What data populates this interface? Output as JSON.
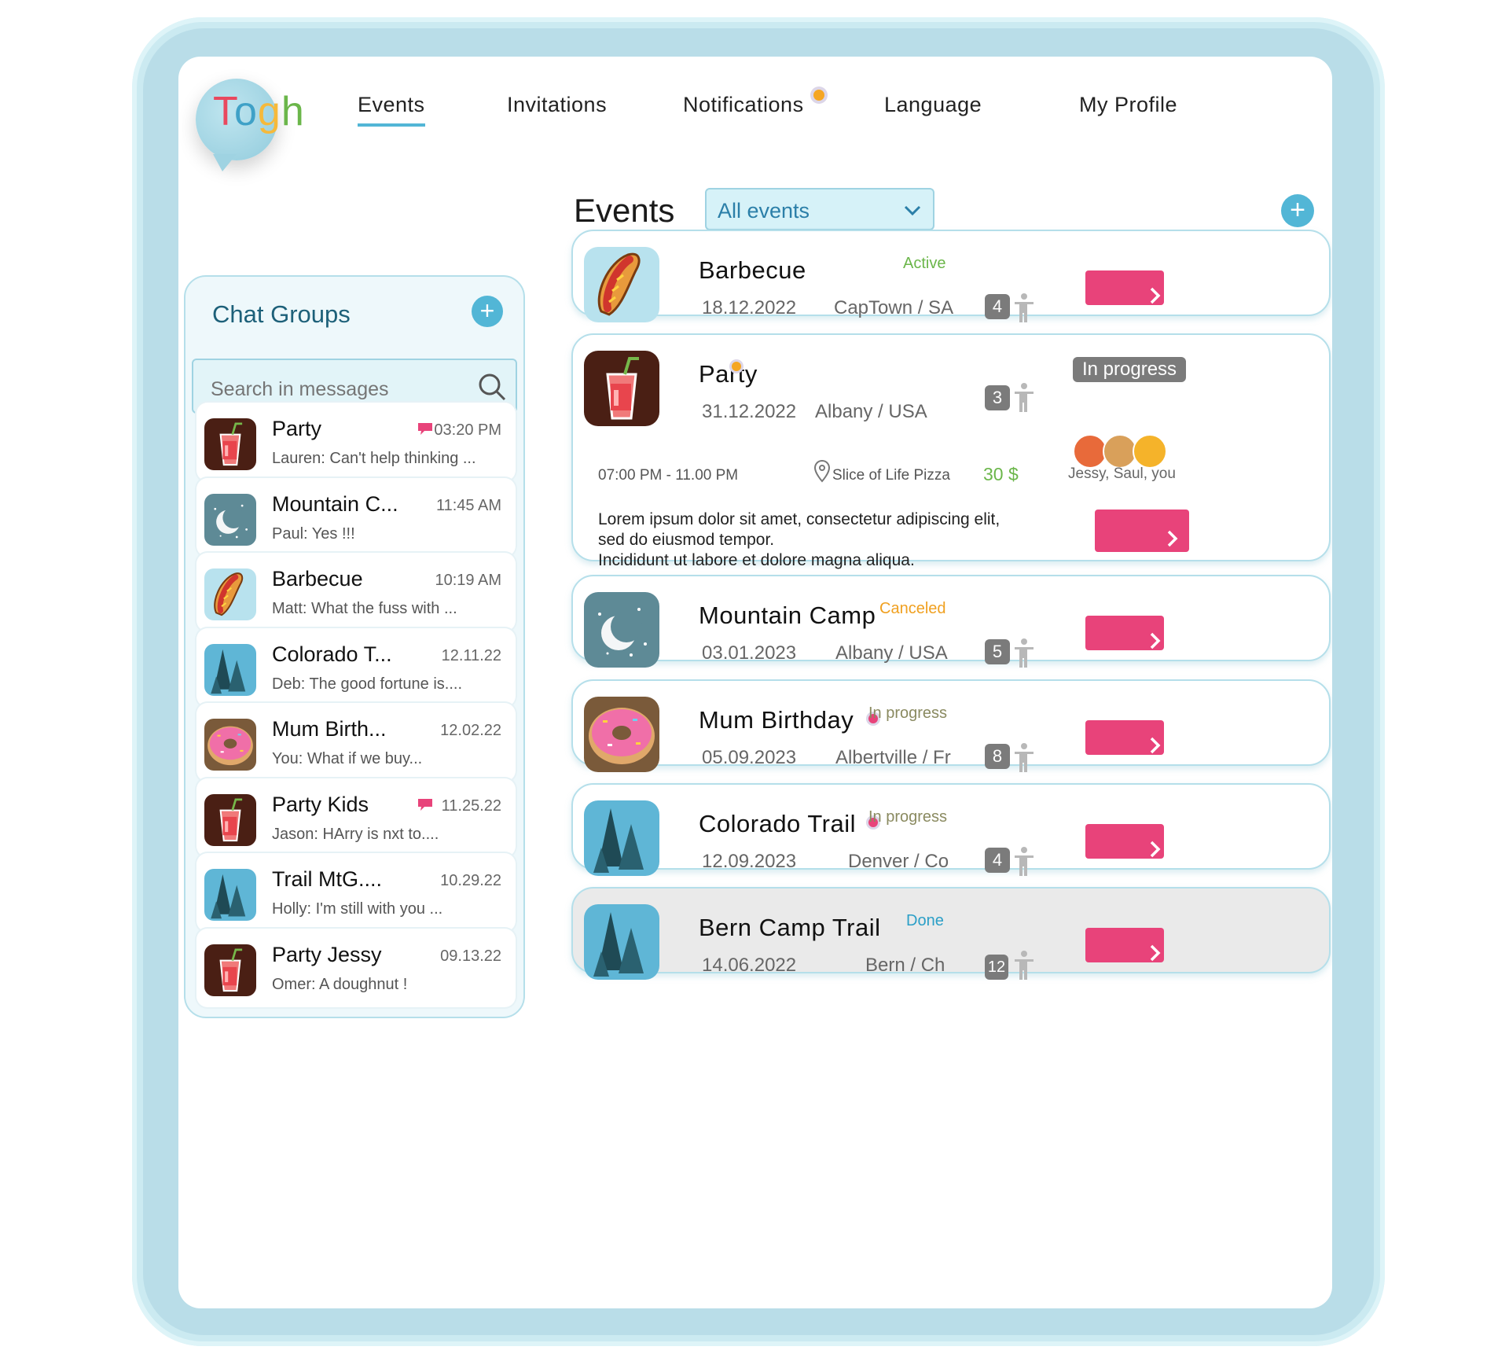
{
  "app": {
    "logo_letters": [
      "T",
      "o",
      "g",
      "h"
    ],
    "logo_colors": [
      "#e9485e",
      "#3fa1c7",
      "#f6b93b",
      "#6bb64a"
    ]
  },
  "nav": {
    "items": [
      {
        "label": "Events"
      },
      {
        "label": "Invitations"
      },
      {
        "label": "Notifications"
      },
      {
        "label": "Language"
      },
      {
        "label": "My Profile"
      }
    ]
  },
  "events_header": {
    "title": "Events",
    "filter_value": "All events"
  },
  "chat": {
    "title": "Chat Groups",
    "search_placeholder": "Search in messages",
    "items": [
      {
        "name": "Party",
        "time": "03:20 PM",
        "message": "Lauren: Can't help thinking ...",
        "icon": "drink-icon",
        "unread": true
      },
      {
        "name": "Mountain C...",
        "time": "11:45 AM",
        "message": "Paul:  Yes !!!",
        "icon": "moon-icon",
        "unread": false
      },
      {
        "name": "Barbecue",
        "time": "10:19 AM",
        "message": "Matt: What the fuss with ...",
        "icon": "hotdog-icon",
        "unread": false
      },
      {
        "name": "Colorado T...",
        "time": "12.11.22",
        "message": "Deb: The good fortune is....",
        "icon": "trees-icon",
        "unread": false
      },
      {
        "name": "Mum Birth...",
        "time": "12.02.22",
        "message": "You: What if we buy...",
        "icon": "donut-icon",
        "unread": false
      },
      {
        "name": "Party Kids",
        "time": "11.25.22",
        "message": "Jason: HArry is nxt to....",
        "icon": "drink-icon",
        "unread": true
      },
      {
        "name": "Trail MtG....",
        "time": "10.29.22",
        "message": "Holly: I'm still with you ...",
        "icon": "trees-icon",
        "unread": false
      },
      {
        "name": "Party Jessy",
        "time": "09.13.22",
        "message": "Omer: A doughnut !",
        "icon": "drink-icon",
        "unread": false
      }
    ]
  },
  "events": [
    {
      "name": "Barbecue",
      "date": "18.12.2022",
      "status": "Active",
      "location": "CapTown / SA",
      "count": "4",
      "icon": "hotdog-icon",
      "status_color": "#6bb64a"
    },
    {
      "name": "Party",
      "date": "31.12.2022",
      "status": "In progress",
      "location": "Albany / USA",
      "count": "3",
      "icon": "drink-icon",
      "time_range": "07:00 PM - 11.00 PM",
      "venue": "Slice of Life Pizza",
      "price": "30 $",
      "attendees": "Jessy, Saul, you",
      "description": [
        "Lorem ipsum dolor sit amet, consectetur adipiscing elit,",
        "sed do eiusmod tempor.",
        "Incididunt ut labore et dolore magna aliqua."
      ]
    },
    {
      "name": "Mountain Camp",
      "date": "03.01.2023",
      "status": "Canceled",
      "location": "Albany / USA",
      "count": "5",
      "icon": "moon-icon",
      "status_color": "#f0a020"
    },
    {
      "name": "Mum Birthday",
      "date": "05.09.2023",
      "status": "In progress",
      "location": "Albertville / Fr",
      "count": "8",
      "icon": "donut-icon",
      "status_color": "#8a8a60"
    },
    {
      "name": "Colorado Trail",
      "date": "12.09.2023",
      "status": "In progress",
      "location": "Denver / Co",
      "count": "4",
      "icon": "trees-icon",
      "status_color": "#8a8a60"
    },
    {
      "name": "Bern Camp Trail",
      "date": "14.06.2022",
      "status": "Done",
      "location": "Bern / Ch",
      "count": "12",
      "icon": "trees-icon",
      "status_color": "#2b9fc7"
    }
  ]
}
